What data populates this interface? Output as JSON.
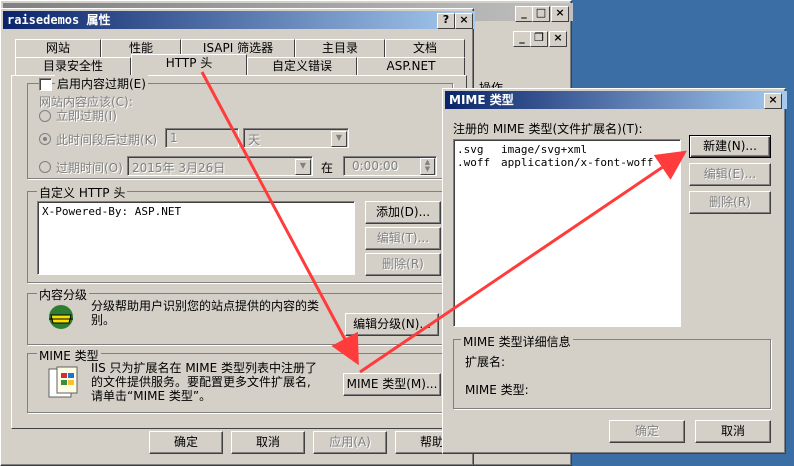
{
  "props": {
    "title": "raisedemos 属性",
    "tabs_row1": [
      "网站",
      "性能",
      "ISAPI 筛选器",
      "主目录",
      "文档"
    ],
    "tabs_row2": [
      "目录安全性",
      "HTTP 头",
      "自定义错误",
      "ASP.NET"
    ],
    "expire": {
      "checkbox_label": "启用内容过期(E)",
      "expire_label": "网站内容应该(C):",
      "immediately": "立即过期(I)",
      "after": "此时间段后过期(K)",
      "after_value": "1",
      "unit": "天",
      "on": "过期时间(O)",
      "date": "2015年 3月26日",
      "at": "在",
      "time": "0:00:00"
    },
    "custom_headers": {
      "group_label": "自定义 HTTP 头",
      "items": [
        "X-Powered-By: ASP.NET"
      ],
      "add": "添加(D)...",
      "edit": "编辑(T)...",
      "remove": "删除(R)"
    },
    "rating": {
      "group_label": "内容分级",
      "desc": "分级帮助用户识别您的站点提供的内容的类别。",
      "button": "编辑分级(N)..."
    },
    "mime": {
      "group_label": "MIME 类型",
      "desc": "IIS 只为扩展名在 MIME 类型列表中注册了的文件提供服务。要配置更多文件扩展名,请单击“MIME 类型”。",
      "button": "MIME 类型(M)..."
    },
    "footer": {
      "ok": "确定",
      "cancel": "取消",
      "apply": "应用(A)",
      "help": "帮助"
    }
  },
  "mime_dialog": {
    "title": "MIME 类型",
    "list_label": "注册的 MIME 类型(文件扩展名)(T):",
    "items": [
      {
        "ext": ".svg",
        "type": "image/svg+xml"
      },
      {
        "ext": ".woff",
        "type": "application/x-font-woff"
      }
    ],
    "new": "新建(N)...",
    "edit": "编辑(E)...",
    "remove": "删除(R)",
    "details_label": "MIME 类型详细信息",
    "ext_label": "扩展名:",
    "type_label": "MIME 类型:",
    "ok": "确定",
    "cancel": "取消"
  },
  "background": {
    "sidebar_label": "操作"
  },
  "colors": {
    "desktop": "#3a6ea5",
    "titlebar_active": "#0a246a",
    "arrow": "#ff3b3b"
  }
}
